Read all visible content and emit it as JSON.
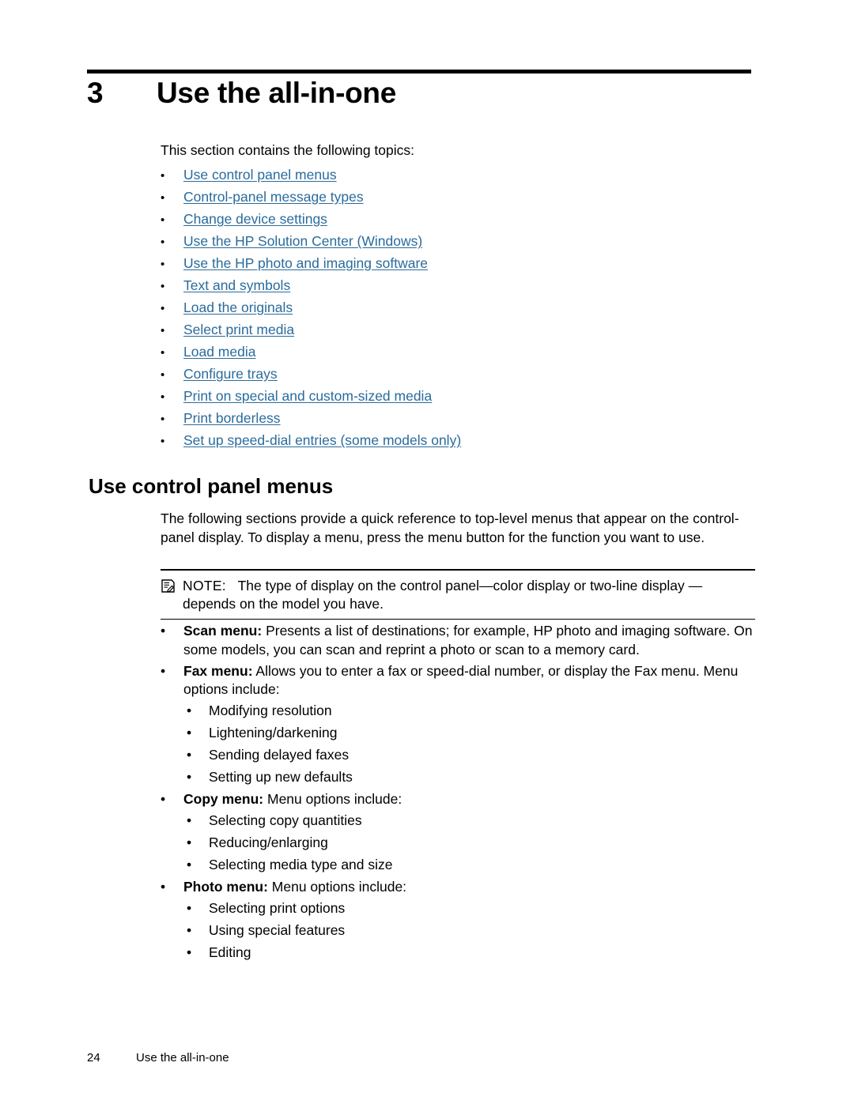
{
  "chapter": {
    "number": "3",
    "title": "Use the all-in-one"
  },
  "intro": "This section contains the following topics:",
  "toc": {
    "bullet": "•",
    "items": [
      "Use control panel menus",
      "Control-panel message types",
      "Change device settings",
      "Use the HP Solution Center (Windows)",
      "Use the HP photo and imaging software",
      "Text and symbols",
      "Load the originals",
      "Select print media",
      "Load media",
      "Configure trays",
      "Print on special and custom-sized media",
      "Print borderless",
      "Set up speed-dial entries (some models only)"
    ],
    "link_color": "#2a6b9c"
  },
  "section": {
    "heading": "Use control panel menus",
    "paragraph": "The following sections provide a quick reference to top-level menus that appear on the control-panel display. To display a menu, press the menu button for the function you want to use."
  },
  "note": {
    "icon": "note-pencil-icon",
    "label": "NOTE:",
    "text": "The type of display on the control panel—color display or two-line display —depends on the model you have."
  },
  "menus": {
    "bullet": "•",
    "items": [
      {
        "term": "Scan menu:",
        "description": " Presents a list of destinations; for example, HP photo and imaging software. On some models, you can scan and reprint a photo or scan to a memory card.",
        "sub": []
      },
      {
        "term": "Fax menu:",
        "description": " Allows you to enter a fax or speed-dial number, or display the Fax menu. Menu options include:",
        "sub": [
          "Modifying resolution",
          "Lightening/darkening",
          "Sending delayed faxes",
          "Setting up new defaults"
        ]
      },
      {
        "term": "Copy menu:",
        "description": " Menu options include:",
        "sub": [
          "Selecting copy quantities",
          "Reducing/enlarging",
          "Selecting media type and size"
        ]
      },
      {
        "term": "Photo menu:",
        "description": " Menu options include:",
        "sub": [
          "Selecting print options",
          "Using special features",
          "Editing"
        ]
      }
    ]
  },
  "footer": {
    "page_number": "24",
    "text": "Use the all-in-one"
  }
}
